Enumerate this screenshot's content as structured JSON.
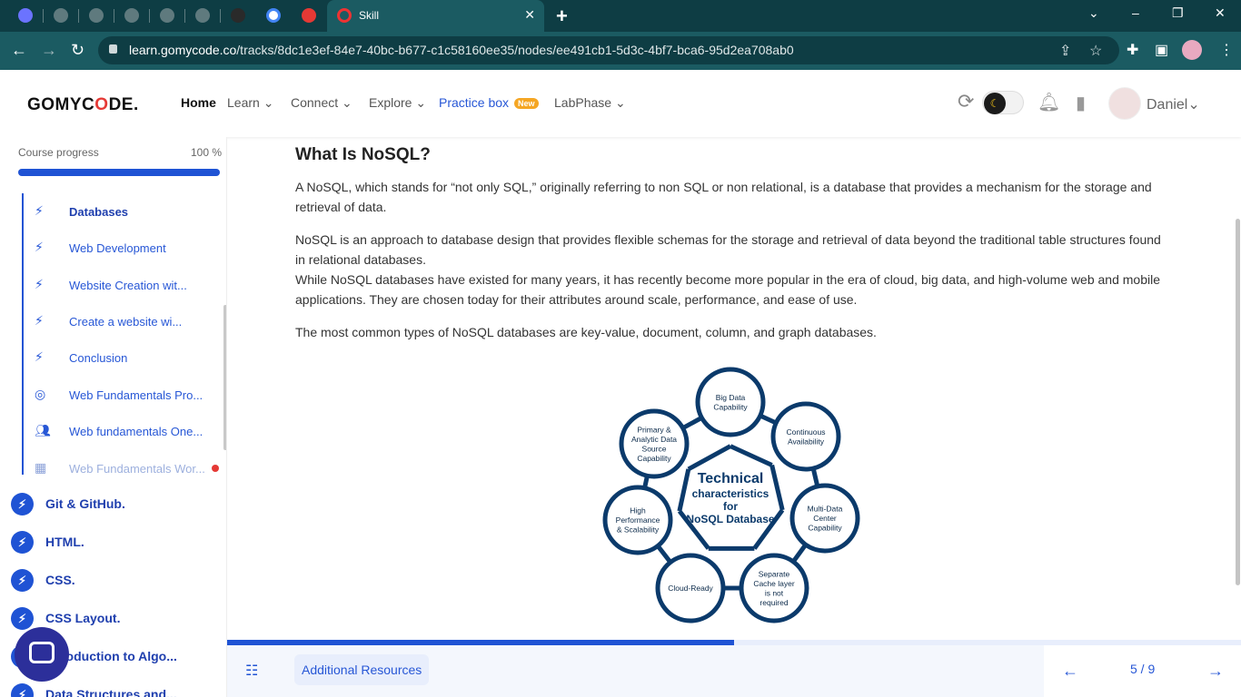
{
  "browser": {
    "active_tab_title": "Skill",
    "url_domain": "learn.gomycode.co",
    "url_path": "/tracks/8dc1e3ef-84e7-40bc-b677-c1c58160ee35/nodes/ee491cb1-5d3c-4bf7-bca6-95d2ea708ab0"
  },
  "app": {
    "logo_prefix": "GOMYC",
    "logo_o": "O",
    "logo_suffix": "DE.",
    "nav": {
      "home": "Home",
      "learn": "Learn",
      "connect": "Connect",
      "explore": "Explore",
      "practice": "Practice box",
      "practice_badge": "New",
      "labphase": "LabPhase"
    },
    "user_name": "Daniel"
  },
  "sidebar": {
    "progress_label": "Course progress",
    "progress_value": "100 %",
    "progress_fraction": 1.0,
    "sub_items": [
      {
        "label": "Databases",
        "icon": "bolt-icon"
      },
      {
        "label": "Web Development",
        "icon": "bolt-icon"
      },
      {
        "label": "Website Creation wit...",
        "icon": "bolt-icon"
      },
      {
        "label": "Create a website wi...",
        "icon": "bolt-icon"
      },
      {
        "label": "Conclusion",
        "icon": "bolt-icon"
      },
      {
        "label": "Web Fundamentals Pro...",
        "icon": "target-icon"
      },
      {
        "label": "Web fundamentals One...",
        "icon": "people-icon"
      },
      {
        "label": "Web Fundamentals Wor...",
        "icon": "workshop-icon"
      }
    ],
    "chapters": [
      {
        "label": "Git & GitHub."
      },
      {
        "label": "HTML."
      },
      {
        "label": "CSS."
      },
      {
        "label": "CSS Layout."
      },
      {
        "label": "Introduction to Algo..."
      },
      {
        "label": "Data Structures and..."
      }
    ]
  },
  "content": {
    "heading": "What Is NoSQL?",
    "p1": "A NoSQL, which stands for “not only SQL,” originally referring to non SQL or non relational, is a database that provides a mechanism for the storage and retrieval of data.",
    "p2": "NoSQL is an approach to database design that provides flexible schemas for the storage and retrieval of data beyond the traditional table structures found in relational databases.",
    "p3": "While NoSQL databases have existed for many years, it has recently become more popular in the era of cloud, big data, and high-volume web and mobile applications. They are chosen today for their attributes around scale, performance, and ease of use.",
    "p4": "The most common types of NoSQL databases are key-value, document, column, and graph databases.",
    "diagram": {
      "center_line1": "Technical",
      "center_line2": "characteristics",
      "center_line3": "for",
      "center_line4": "NoSQL Database",
      "nodes": [
        [
          "Big Data",
          "Capability"
        ],
        [
          "Continuous",
          "Availability"
        ],
        [
          "Multi-Data",
          "Center",
          "Capability"
        ],
        [
          "Separate",
          "Cache layer",
          "is not",
          "required"
        ],
        [
          "Cloud-Ready"
        ],
        [
          "High",
          "Performance",
          "& Scalability"
        ],
        [
          "Primary &",
          "Analytic Data",
          "Source",
          "Capability"
        ]
      ]
    }
  },
  "footer": {
    "resources_label": "Additional Resources",
    "page_counter": "5 / 9",
    "lesson_progress_fraction": 0.5
  },
  "colors": {
    "brand_blue": "#1f53d4",
    "diagram_navy": "#0b3a6b",
    "alert_red": "#e53935",
    "badge_orange": "#f5a623"
  }
}
